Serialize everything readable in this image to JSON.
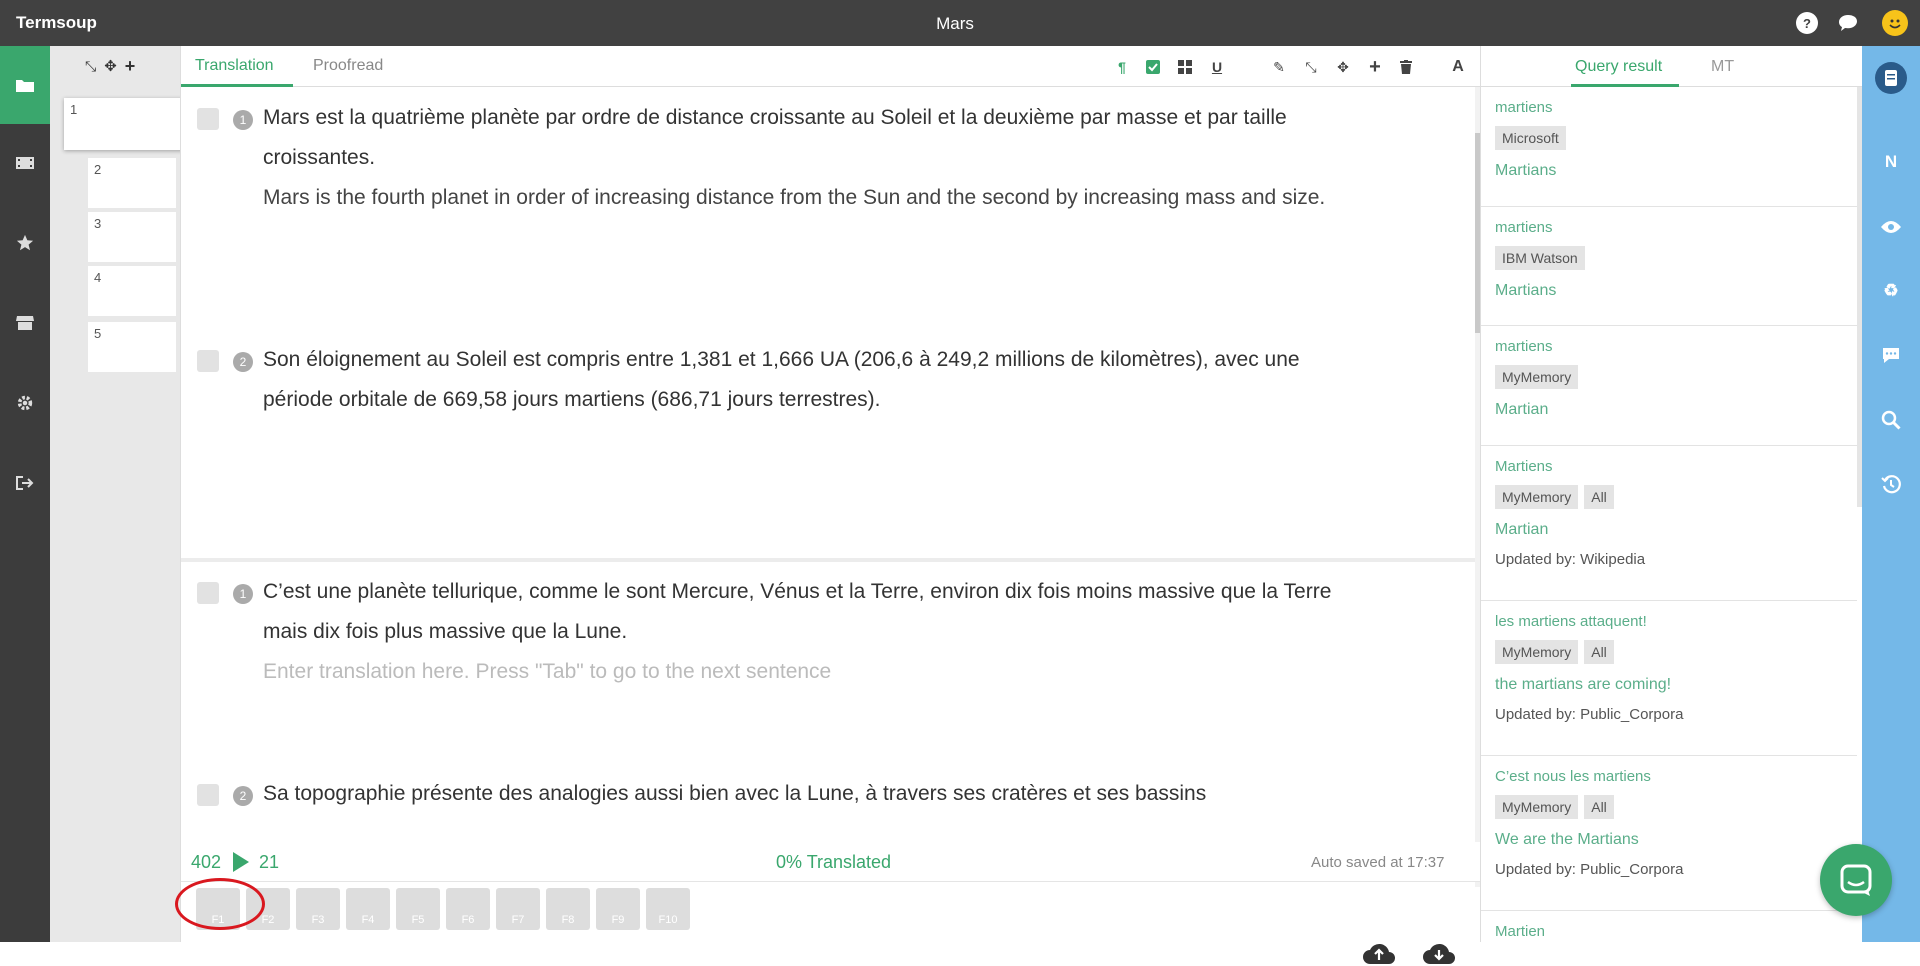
{
  "app": {
    "brand": "Termsoup",
    "doc_title": "Mars"
  },
  "colors": {
    "accent": "#3aa76d",
    "dark": "#414141",
    "blue": "#74b8e8"
  },
  "sidebar": {
    "icons": [
      "folder-icon",
      "film-icon",
      "star-icon",
      "store-icon",
      "gear-icon",
      "sign-out-icon"
    ]
  },
  "segments": [
    "1",
    "2",
    "3",
    "4",
    "5"
  ],
  "editor": {
    "tabs": [
      "Translation",
      "Proofread"
    ],
    "sentences": [
      {
        "num": "1",
        "source": "Mars est la quatrième planète par ordre de distance croissante au Soleil et la deuxième par masse et par taille croissantes.",
        "target": "Mars is the fourth planet in order of increasing distance from the Sun and the second by increasing mass and size."
      },
      {
        "num": "2",
        "source": "Son éloignement au Soleil est compris entre 1,381 et 1,666 UA (206,6 à 249,2 millions de kilomètres), avec une période orbitale de 669,58 jours martiens (686,71 jours terrestres).",
        "target": ""
      },
      {
        "num": "1",
        "source": "C’est une planète tellurique, comme le sont Mercure, Vénus et la Terre, environ dix fois moins massive que la Terre mais dix fois plus massive que la Lune.",
        "placeholder": "Enter translation here. Press \"Tab\" to go to the next sentence"
      },
      {
        "num": "2",
        "source": "Sa topographie présente des analogies aussi bien avec la Lune, à travers ses cratères et ses bassins"
      }
    ],
    "status": {
      "count_left": "402",
      "count_right": "21",
      "translated": "0% Translated",
      "saved": "Auto saved at 17:37"
    },
    "fkeys": [
      "F1",
      "F2",
      "F3",
      "F4",
      "F5",
      "F6",
      "F7",
      "F8",
      "F9",
      "F10"
    ]
  },
  "query": {
    "tabs": [
      "Query result",
      "MT"
    ],
    "results": [
      {
        "src": "martiens",
        "tags": [
          "Microsoft"
        ],
        "tgt": "Martians",
        "upd_label": "",
        "upd_value": ""
      },
      {
        "src": "martiens",
        "tags": [
          "IBM Watson"
        ],
        "tgt": "Martians",
        "upd_label": "",
        "upd_value": ""
      },
      {
        "src": "martiens",
        "tags": [
          "MyMemory"
        ],
        "tgt": "Martian",
        "upd_label": "",
        "upd_value": ""
      },
      {
        "src": "Martiens",
        "tags": [
          "MyMemory",
          "All"
        ],
        "tgt": "Martian",
        "upd_label": "Updated by:",
        "upd_value": "Wikipedia"
      },
      {
        "src": "les martiens attaquent!",
        "tags": [
          "MyMemory",
          "All"
        ],
        "tgt": "the martians are coming!",
        "upd_label": "Updated by:",
        "upd_value": "Public_Corpora"
      },
      {
        "src": "C’est nous les martiens",
        "tags": [
          "MyMemory",
          "All"
        ],
        "tgt": "We are the Martians",
        "upd_label": "Updated by:",
        "upd_value": "Public_Corpora"
      },
      {
        "src": "Martien",
        "tags": [],
        "tgt": "",
        "upd_label": "",
        "upd_value": ""
      }
    ]
  },
  "rightbar": {
    "icons": [
      "notebook-icon",
      "n-icon",
      "eye-icon",
      "recycle-icon",
      "comment-icon",
      "search-icon",
      "history-icon"
    ],
    "n_label": "N"
  }
}
